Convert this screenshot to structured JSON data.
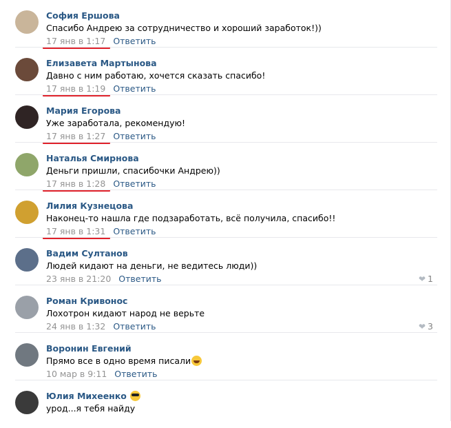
{
  "comments": [
    {
      "author": "София Ершова",
      "text": "Спасибо Андрею за сотрудничество и хороший заработок!))",
      "date": "17 янв в 1:17",
      "reply": "Ответить",
      "likes": "",
      "avatar_color": "#c9b59a",
      "underlined": true
    },
    {
      "author": "Елизавета Мартынова",
      "text": "Давно с ним работаю, хочется сказать спасибо!",
      "date": "17 янв в 1:19",
      "reply": "Ответить",
      "likes": "",
      "avatar_color": "#6b4a3a",
      "underlined": true
    },
    {
      "author": "Мария Егорова",
      "text": "Уже заработала, рекомендую!",
      "date": "17 янв в 1:27",
      "reply": "Ответить",
      "likes": "",
      "avatar_color": "#2f2424",
      "underlined": true
    },
    {
      "author": "Наталья Смирнова",
      "text": "Деньги пришли, спасибочки Андрею))",
      "date": "17 янв в 1:28",
      "reply": "Ответить",
      "likes": "",
      "avatar_color": "#8fa66a",
      "underlined": true
    },
    {
      "author": "Лилия Кузнецова",
      "text": "Наконец-то нашла где подзаработать, всё получила, спасибо!!",
      "date": "17 янв в 1:31",
      "reply": "Ответить",
      "likes": "",
      "avatar_color": "#d0a030",
      "underlined": true
    },
    {
      "author": "Вадим Султанов",
      "text": "Людей кидают на деньги, не ведитесь люди))",
      "date": "23 янв в 21:20",
      "reply": "Ответить",
      "likes": "1",
      "avatar_color": "#5c6f8a",
      "underlined": false
    },
    {
      "author": "Роман Кривонос",
      "text": "Лохотрон кидают народ не верьте",
      "date": "24 янв в 1:32",
      "reply": "Ответить",
      "likes": "3",
      "avatar_color": "#9aa0a8",
      "underlined": false
    },
    {
      "author": "Воронин Евгений",
      "text": "Прямо все в одно время писали",
      "date": "10 мар в 9:11",
      "reply": "Ответить",
      "likes": "",
      "avatar_color": "#707880",
      "underlined": false
    },
    {
      "author": "Юлия Михеенко",
      "text": "урод...я тебя найду",
      "date": "",
      "reply": "",
      "likes": "",
      "avatar_color": "#3a3a3a",
      "underlined": false
    }
  ],
  "colors": {
    "link": "#2a5885",
    "date": "#939393",
    "underline": "#e0212a"
  }
}
